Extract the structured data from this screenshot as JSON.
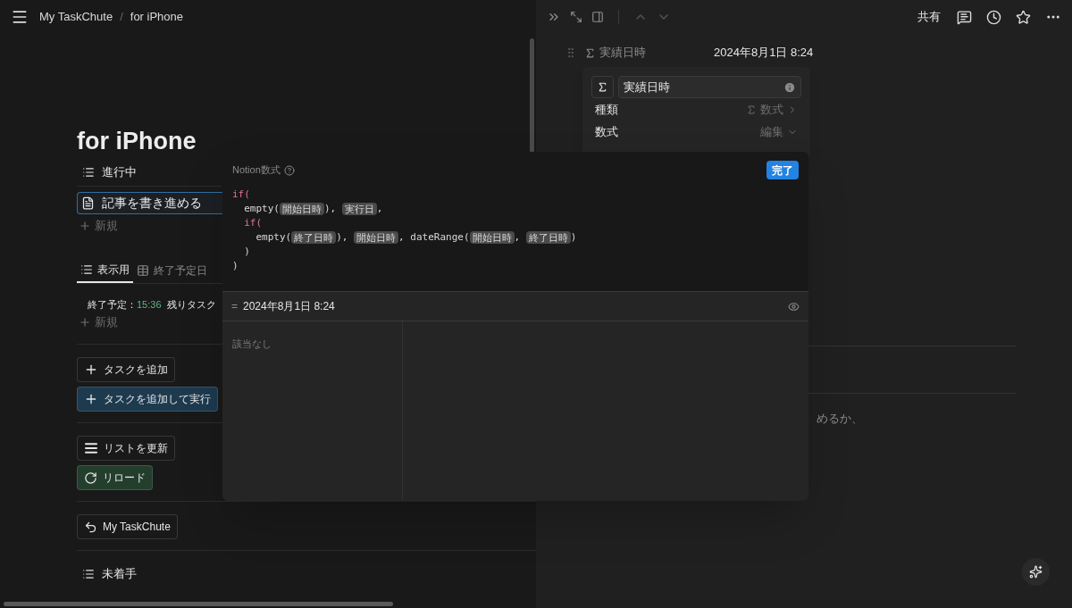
{
  "breadcrumb": {
    "items": [
      "My TaskChute",
      "for iPhone"
    ],
    "separator": "/"
  },
  "page": {
    "title": "for iPhone",
    "in_progress": {
      "label": "進行中",
      "items": [
        {
          "title": "記事を書き進める",
          "selected": true
        }
      ],
      "new_label": "新規"
    },
    "views": {
      "tabs": [
        {
          "label": "表示用",
          "selected": true,
          "kind": "list"
        },
        {
          "label": "終了予定日",
          "selected": false,
          "kind": "table"
        }
      ],
      "summary": {
        "label": "終了予定：",
        "time": "15:36",
        "rest": "残りタスク"
      },
      "new_label": "新規"
    },
    "buttons": [
      {
        "label": "タスクを追加",
        "kind": "plus",
        "color": "#191919"
      },
      {
        "label": "タスクを追加して実行",
        "kind": "plus",
        "color": "#1d3a4f"
      },
      {
        "label": "リストを更新",
        "kind": "list",
        "color": "#191919"
      },
      {
        "label": "リロード",
        "kind": "reload",
        "color": "#233e2d"
      },
      {
        "label": "My TaskChute",
        "kind": "back",
        "color": "#191919"
      }
    ],
    "not_started": {
      "label": "未着手"
    }
  },
  "side_peek": {
    "share": "共有",
    "property": {
      "name": "実績日時",
      "value": "2024年8月1日 8:24"
    },
    "body_text": "めるか、"
  },
  "property_menu": {
    "name": "実績日時",
    "rows": [
      {
        "label": "種類",
        "value": "数式",
        "kind": "type"
      },
      {
        "label": "数式",
        "value": "編集",
        "kind": "edit"
      }
    ]
  },
  "formula_editor": {
    "title": "Notion数式",
    "done": "完了",
    "lines": [
      [
        {
          "kind": "keyword",
          "text": "if("
        }
      ],
      [
        {
          "kind": "code",
          "text": "  empty("
        },
        {
          "kind": "chip",
          "text": "開始日時"
        },
        {
          "kind": "code",
          "text": "), "
        },
        {
          "kind": "chip",
          "text": "実行日"
        },
        {
          "kind": "code",
          "text": ","
        }
      ],
      [
        {
          "kind": "keyword",
          "text": "  if("
        }
      ],
      [
        {
          "kind": "code",
          "text": "    empty("
        },
        {
          "kind": "chip",
          "text": "終了日時"
        },
        {
          "kind": "code",
          "text": "), "
        },
        {
          "kind": "chip",
          "text": "開始日時"
        },
        {
          "kind": "code",
          "text": ", dateRange("
        },
        {
          "kind": "chip",
          "text": "開始日時"
        },
        {
          "kind": "code",
          "text": ", "
        },
        {
          "kind": "chip",
          "text": "終了日時"
        },
        {
          "kind": "code",
          "text": ")"
        }
      ],
      [
        {
          "kind": "code",
          "text": "  )"
        }
      ],
      [
        {
          "kind": "code",
          "text": ")"
        }
      ]
    ],
    "result_prefix": "=",
    "result": "2024年8月1日 8:24",
    "empty_text": "該当なし"
  }
}
